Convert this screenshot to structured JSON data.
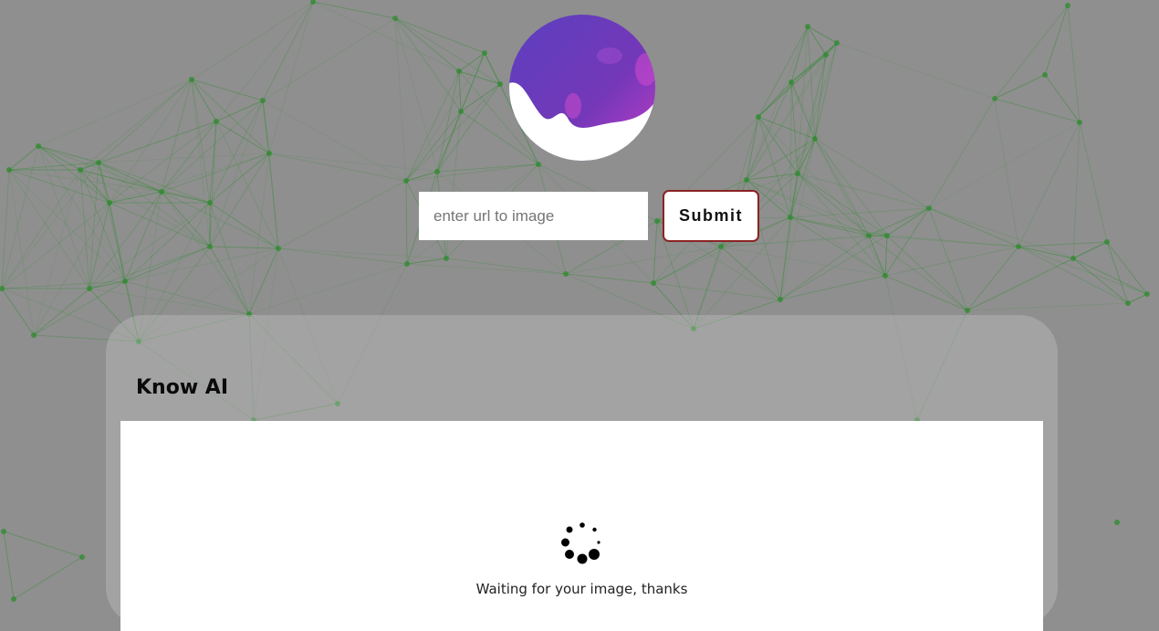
{
  "header": {
    "logo_icon": "purple-wave-logo-icon"
  },
  "search": {
    "placeholder": "enter url to image",
    "value": "",
    "submit_label": "Submit"
  },
  "panel": {
    "title": "Know AI",
    "status_text": "Waiting for your image, thanks",
    "spinner_icon": "loading-spinner-icon"
  },
  "colors": {
    "background": "#8f8f8f",
    "network_lines": "#2e8b2e",
    "logo_primary": "#6a3fb5",
    "logo_accent": "#b03bbd",
    "submit_border": "#8b2323"
  }
}
